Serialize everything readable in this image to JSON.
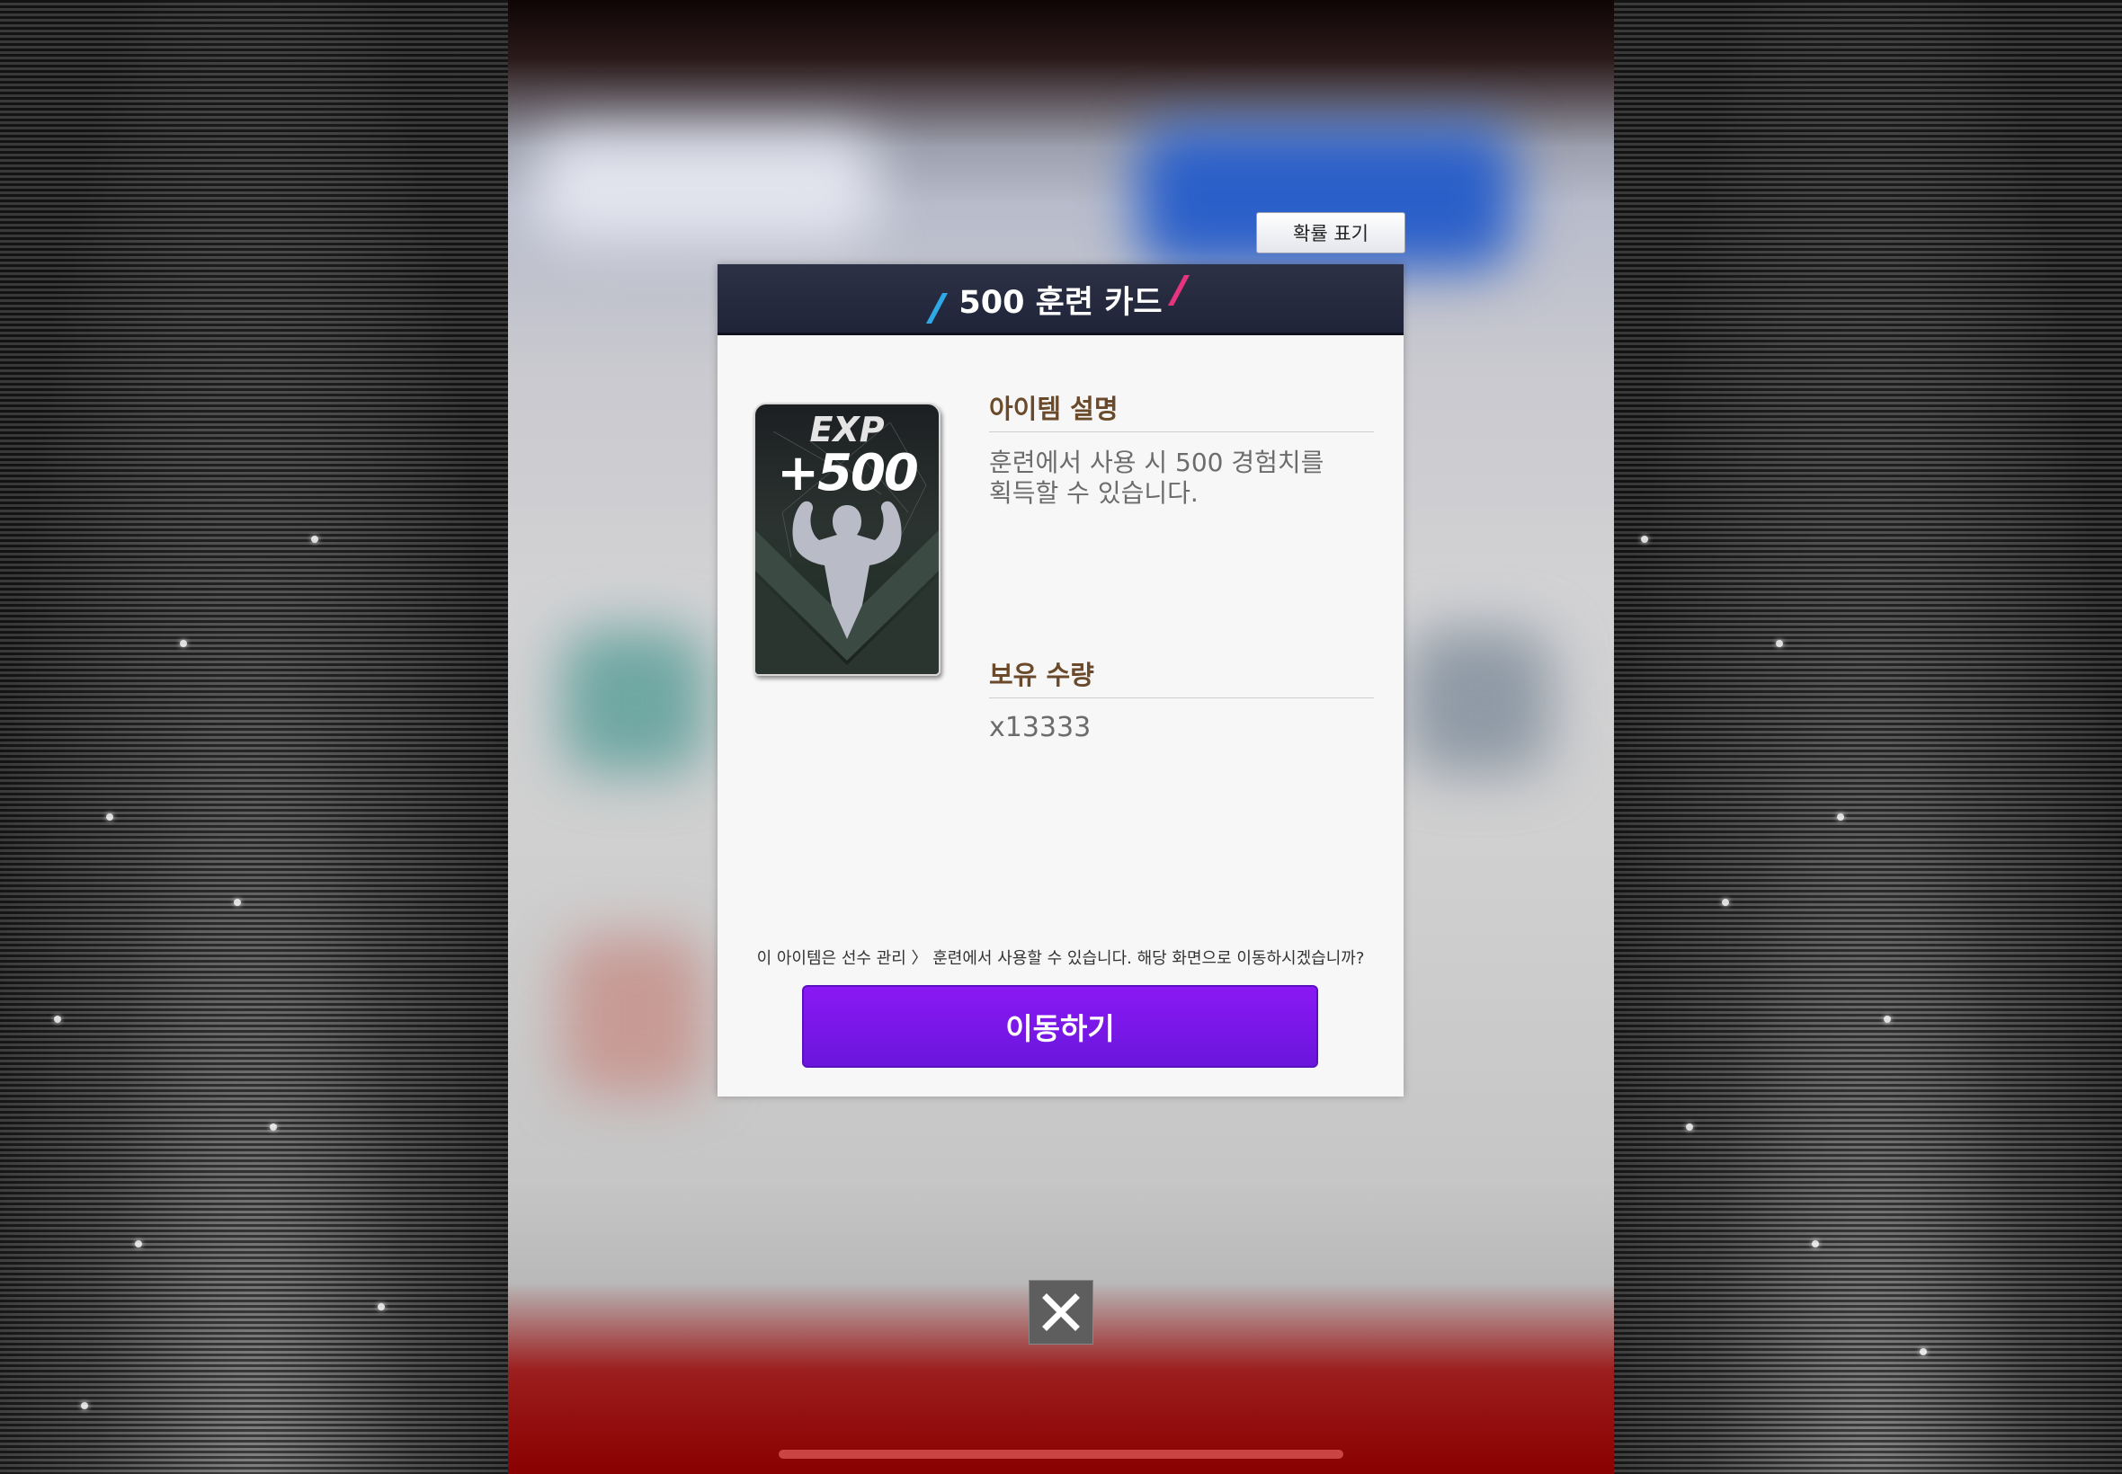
{
  "header": {
    "probability_button": "확률 표기"
  },
  "dialog": {
    "title": "500 훈련 카드",
    "card": {
      "exp_label": "EXP",
      "value_label": "+500",
      "icon": "muscle-figure-icon"
    },
    "description_title": "아이템 설명",
    "description_line1": "훈련에서 사용 시 500 경험치를",
    "description_line2": "획득할 수 있습니다.",
    "quantity_title": "보유 수량",
    "quantity_value": "x13333",
    "notice": "이 아이템은 선수 관리 〉 훈련에서 사용할 수 있습니다. 해당 화면으로 이동하시겠습니까?",
    "move_button": "이동하기"
  },
  "close_button": {
    "icon": "close-icon"
  },
  "colors": {
    "header_bg": "#2c3145",
    "accent_purple": "#8a18f4",
    "section_title": "#6b4a2c",
    "slash_blue": "#2fa9e6",
    "slash_pink": "#e6347f"
  }
}
